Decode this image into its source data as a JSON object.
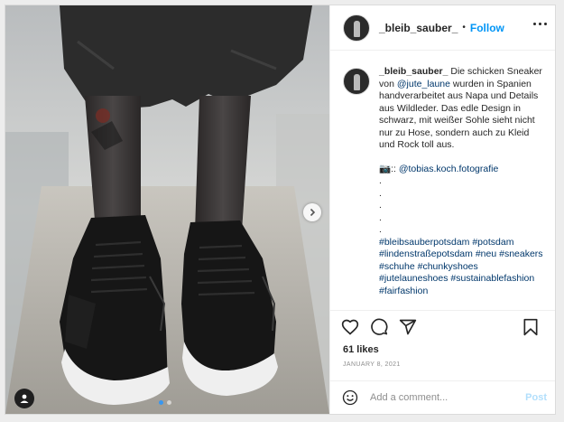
{
  "colors": {
    "accent": "#0095f6",
    "link": "#00376b",
    "muted": "#8e8e8e",
    "post_disabled": "#b2dffc",
    "carousel_active_dot": "#3897f0"
  },
  "media": {
    "description_icon": "sneaker-photo",
    "carousel": {
      "current": 1,
      "total": 2
    },
    "next_icon": "chevron-right-icon",
    "tag_icon": "user-tag-icon"
  },
  "header": {
    "username": "_bleib_sauber_",
    "separator": "•",
    "follow_label": "Follow",
    "more_icon": "more-options-icon"
  },
  "caption": {
    "username": "_bleib_sauber_",
    "text_1": " Die schicken Sneaker von ",
    "mention": "@jute_laune",
    "text_2": " wurden in Spanien handverarbeitet aus Napa und Details aus Wildleder. Das edle Design in schwarz, mit weißer Sohle sieht nicht nur zu Hose, sondern auch zu Kleid und Rock toll aus.",
    "credit_prefix": "📷:: ",
    "credit_mention": "@tobias.koch.fotografie",
    "dots": [
      ".",
      ".",
      ".",
      ".",
      "."
    ],
    "hashtags": [
      "#bleibsauberpotsdam",
      "#potsdam",
      "#lindenstraßepotsdam",
      "#neu",
      "#sneakers",
      "#schuhe",
      "#chunkyshoes",
      "#jutelauneshoes",
      "#sustainablefashion",
      "#fairfashion"
    ]
  },
  "actions": {
    "like_icon": "heart-icon",
    "comment_icon": "comment-icon",
    "share_icon": "share-icon",
    "save_icon": "bookmark-icon"
  },
  "likes": "61 likes",
  "date": "JANUARY 8, 2021",
  "comment": {
    "emoji_icon": "emoji-icon",
    "placeholder": "Add a comment...",
    "value": "",
    "post_label": "Post"
  }
}
